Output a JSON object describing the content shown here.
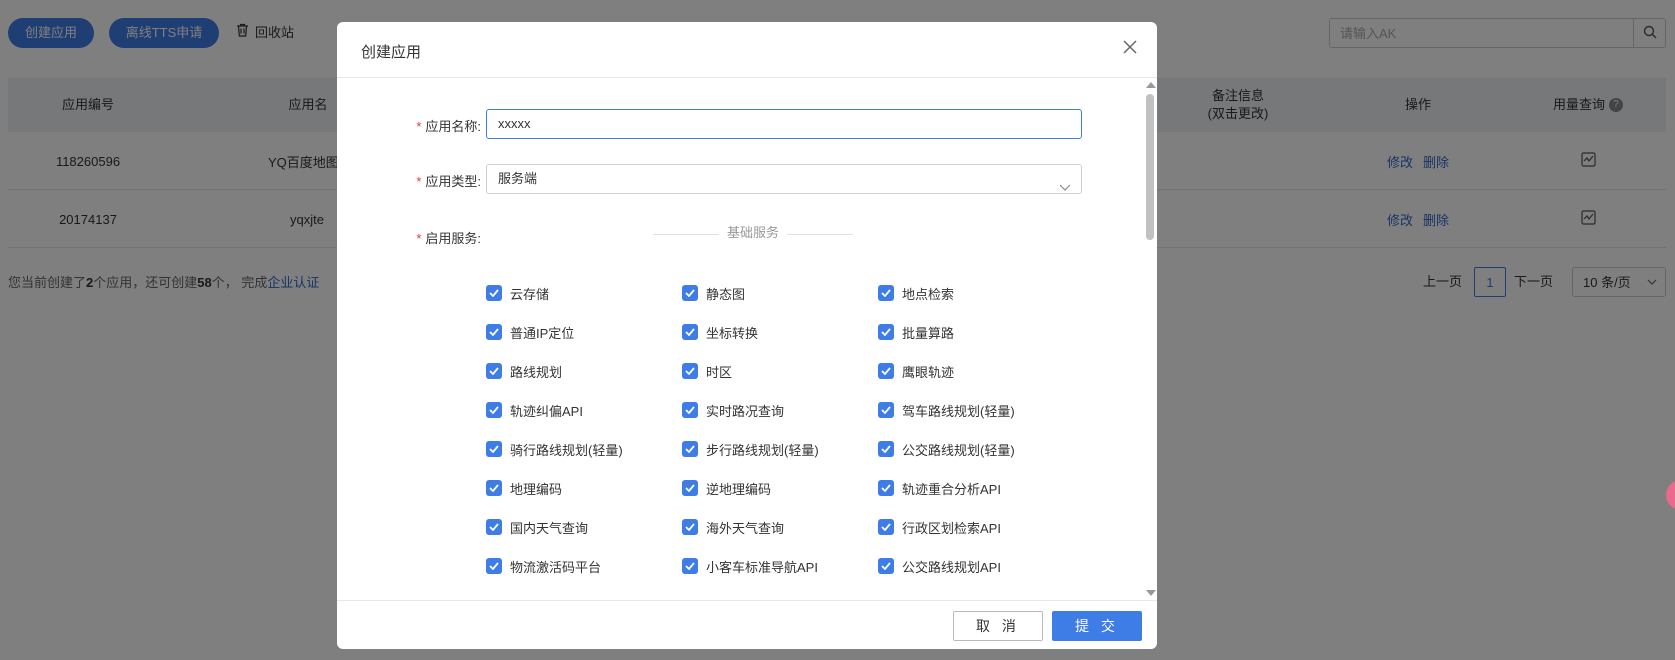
{
  "toolbar": {
    "create_app": "创建应用",
    "offline_tts": "离线TTS申请",
    "recycle_bin": "回收站",
    "search_placeholder": "请输入AK"
  },
  "table": {
    "headers": {
      "app_id": "应用编号",
      "app_name": "应用名",
      "remark_line1": "备注信息",
      "remark_line2": "(双击更改)",
      "actions": "操作",
      "usage": "用量查询"
    },
    "rows": [
      {
        "app_id": "118260596",
        "app_name": "YQ百度地图M",
        "edit": "修改",
        "delete": "删除"
      },
      {
        "app_id": "20174137",
        "app_name": "yqxjte",
        "edit": "修改",
        "delete": "删除"
      }
    ]
  },
  "summary": {
    "prefix": "您当前创建了",
    "created": "2",
    "mid": "个应用，还可创建",
    "remaining": "58",
    "suffix": "个，  完成",
    "link": "企业认证"
  },
  "pager": {
    "prev": "上一页",
    "current": "1",
    "next": "下一页",
    "page_size": "10 条/页"
  },
  "modal": {
    "title": "创建应用",
    "name_label": "应用名称:",
    "name_value": "xxxxx",
    "type_label": "应用类型:",
    "type_value": "服务端",
    "services_label": "启用服务:",
    "section_label": "基础服务",
    "services": [
      {
        "label": "云存储",
        "checked": true
      },
      {
        "label": "静态图",
        "checked": true
      },
      {
        "label": "地点检索",
        "checked": true
      },
      {
        "label": "普通IP定位",
        "checked": true
      },
      {
        "label": "坐标转换",
        "checked": true
      },
      {
        "label": "批量算路",
        "checked": true
      },
      {
        "label": "路线规划",
        "checked": true
      },
      {
        "label": "时区",
        "checked": true
      },
      {
        "label": "鹰眼轨迹",
        "checked": true
      },
      {
        "label": "轨迹纠偏API",
        "checked": true
      },
      {
        "label": "实时路况查询",
        "checked": true
      },
      {
        "label": "驾车路线规划(轻量)",
        "checked": true
      },
      {
        "label": "骑行路线规划(轻量)",
        "checked": true
      },
      {
        "label": "步行路线规划(轻量)",
        "checked": true
      },
      {
        "label": "公交路线规划(轻量)",
        "checked": true
      },
      {
        "label": "地理编码",
        "checked": true
      },
      {
        "label": "逆地理编码",
        "checked": true
      },
      {
        "label": "轨迹重合分析API",
        "checked": true
      },
      {
        "label": "国内天气查询",
        "checked": true
      },
      {
        "label": "海外天气查询",
        "checked": true
      },
      {
        "label": "行政区划检索API",
        "checked": true
      },
      {
        "label": "物流激活码平台",
        "checked": true
      },
      {
        "label": "小客车标准导航API",
        "checked": true
      },
      {
        "label": "公交路线规划API",
        "checked": true
      }
    ],
    "cancel": "取 消",
    "submit": "提 交"
  },
  "colors": {
    "accent": "#3e7ce6",
    "link": "#3366cc",
    "required": "#e53935"
  }
}
